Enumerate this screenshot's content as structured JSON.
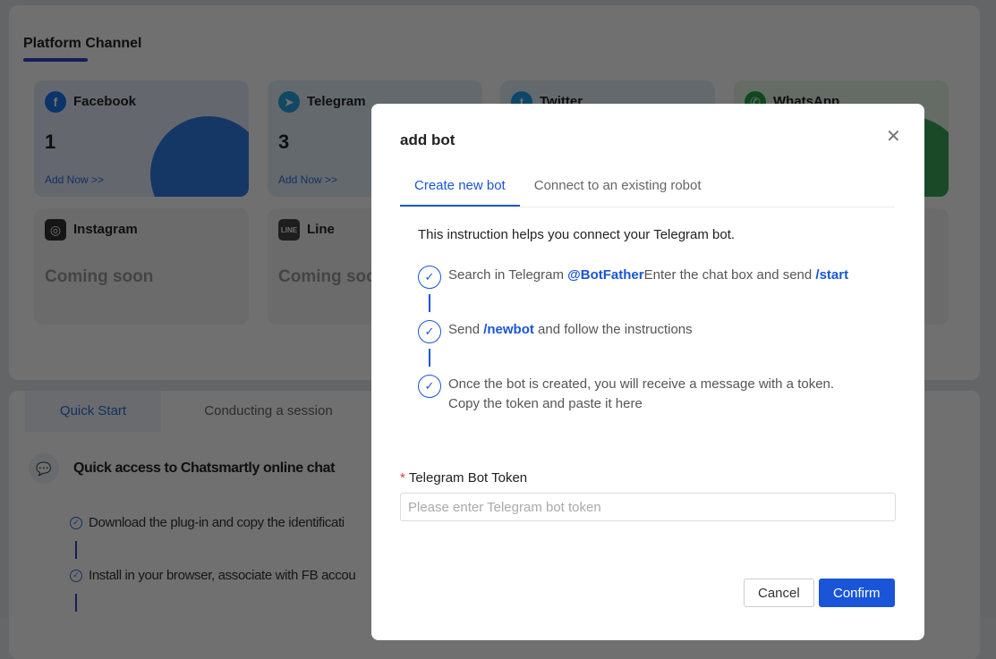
{
  "platform": {
    "title": "Platform Channel",
    "cards": [
      {
        "name": "Facebook",
        "count": "1",
        "action": "Add Now >>",
        "icon": "facebook-icon",
        "color": "#1877f2"
      },
      {
        "name": "Telegram",
        "count": "3",
        "action": "Add Now >>",
        "icon": "telegram-icon",
        "color": "#2aa3e0"
      },
      {
        "name": "Twitter",
        "icon": "twitter-icon",
        "color": "#1da1f2"
      },
      {
        "name": "WhatsApp",
        "icon": "whatsapp-icon",
        "color": "#25a244"
      },
      {
        "name": "Instagram",
        "status": "Coming soon",
        "icon": "instagram-icon"
      },
      {
        "name": "Line",
        "status": "Coming soon",
        "icon": "line-icon"
      }
    ]
  },
  "guide": {
    "tabs": [
      "Quick Start",
      "Conducting a session"
    ],
    "heading": "Quick access to Chatsmartly online chat",
    "steps": [
      "Download the plug-in and copy the identificati",
      "Install in your browser, associate with FB accou"
    ]
  },
  "modal": {
    "title": "add bot",
    "tabs": [
      "Create new bot",
      "Connect to an existing robot"
    ],
    "intro": "This instruction helps you connect your Telegram bot.",
    "step1": {
      "a": "Search in Telegram ",
      "b": "@BotFather",
      "c": "Enter the chat box and send ",
      "d": "/start"
    },
    "step2": {
      "a": "Send ",
      "b": "/newbot",
      "c": " and follow the instructions"
    },
    "step3": "Once the bot is created, you will receive a message with a token. Copy the token and paste it here",
    "token_label": "Telegram Bot Token",
    "token_placeholder": "Please enter Telegram bot token",
    "cancel": "Cancel",
    "confirm": "Confirm",
    "accent": "#1a55d8"
  }
}
